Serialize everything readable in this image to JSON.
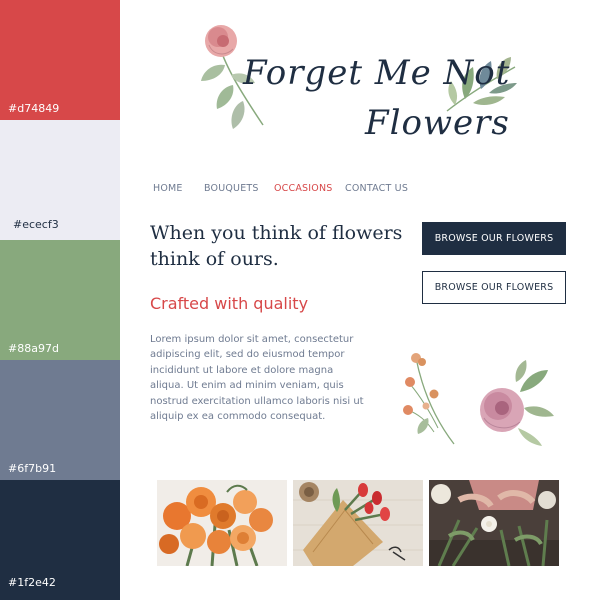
{
  "palette": [
    {
      "hex": "#d74849",
      "label": "#d74849"
    },
    {
      "hex": "#ececf3",
      "label": "#ececf3"
    },
    {
      "hex": "#88a97d",
      "label": "#88a97d"
    },
    {
      "hex": "#6f7b91",
      "label": "#6f7b91"
    },
    {
      "hex": "#1f2e42",
      "label": "#1f2e42"
    }
  ],
  "logo": {
    "line1": "Forget Me Not",
    "line2": "Flowers"
  },
  "nav": {
    "items": [
      {
        "label": "HOME",
        "active": false
      },
      {
        "label": "BOUQUETS",
        "active": false
      },
      {
        "label": "OCCASIONS",
        "active": true
      },
      {
        "label": "CONTACT US",
        "active": false
      }
    ]
  },
  "hero": {
    "headline": "When you think of flowers think of ours.",
    "subhead": "Crafted with quality",
    "body": "Lorem ipsum dolor sit amet, consectetur adipiscing elit, sed do eiusmod tempor incididunt ut labore et dolore magna aliqua. Ut enim ad minim veniam, quis nostrud exercitation ullamco laboris nisi ut aliquip ex ea commodo consequat."
  },
  "buttons": {
    "primary_label": "BROWSE OUR FLOWERS",
    "secondary_label": "BROWSE OUR FLOWERS"
  },
  "icons": {
    "logo_illustration": "rose-branch-illustration",
    "side_illustration": "floral-bouquet-illustration",
    "photo1": "orange-roses-photo",
    "photo2": "red-tulips-bouquet-photo",
    "photo3": "florist-arranging-photo"
  },
  "colors": {
    "accent_red": "#d74849",
    "light_gray": "#ececf3",
    "sage_green": "#88a97d",
    "slate_blue": "#6f7b91",
    "navy": "#1f2e42"
  }
}
